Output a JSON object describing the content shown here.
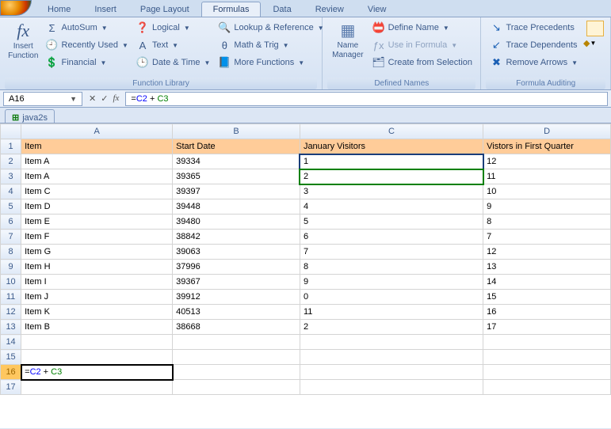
{
  "tabs": [
    "Home",
    "Insert",
    "Page Layout",
    "Formulas",
    "Data",
    "Review",
    "View"
  ],
  "active_tab": "Formulas",
  "ribbon": {
    "function_library": {
      "insert_function": "Insert Function",
      "items": [
        "AutoSum",
        "Recently Used",
        "Financial",
        "Logical",
        "Text",
        "Date & Time",
        "Lookup & Reference",
        "Math & Trig",
        "More Functions"
      ],
      "label": "Function Library"
    },
    "defined_names": {
      "name_manager": "Name Manager",
      "items": [
        "Define Name",
        "Use in Formula",
        "Create from Selection"
      ],
      "label": "Defined Names"
    },
    "formula_auditing": {
      "items": [
        "Trace Precedents",
        "Trace Dependents",
        "Remove Arrows"
      ],
      "label": "Formula Auditing"
    }
  },
  "name_box": "A16",
  "formula_bar": "=C2 + C3",
  "workbook_tab": "java2s",
  "columns": [
    "A",
    "B",
    "C",
    "D"
  ],
  "headers": [
    "Item",
    "Start Date",
    "January Visitors",
    "Vistors in First Quarter"
  ],
  "rows": [
    {
      "n": 1,
      "data": [
        "Item",
        "Start Date",
        "January Visitors",
        "Vistors in First Quarter"
      ],
      "header": true
    },
    {
      "n": 2,
      "data": [
        "Item A",
        "39334",
        "1",
        "12"
      ]
    },
    {
      "n": 3,
      "data": [
        "Item A",
        "39365",
        "2",
        "11"
      ]
    },
    {
      "n": 4,
      "data": [
        "Item C",
        "39397",
        "3",
        "10"
      ]
    },
    {
      "n": 5,
      "data": [
        "Item D",
        "39448",
        "4",
        "9"
      ]
    },
    {
      "n": 6,
      "data": [
        "Item E",
        "39480",
        "5",
        "8"
      ]
    },
    {
      "n": 7,
      "data": [
        "Item F",
        "38842",
        "6",
        "7"
      ]
    },
    {
      "n": 8,
      "data": [
        "Item G",
        "39063",
        "7",
        "12"
      ]
    },
    {
      "n": 9,
      "data": [
        "Item H",
        "37996",
        "8",
        "13"
      ]
    },
    {
      "n": 10,
      "data": [
        "Item I",
        "39367",
        "9",
        "14"
      ]
    },
    {
      "n": 11,
      "data": [
        "Item J",
        "39912",
        "0",
        "15"
      ]
    },
    {
      "n": 12,
      "data": [
        "Item K",
        "40513",
        "11",
        "16"
      ]
    },
    {
      "n": 13,
      "data": [
        "Item B",
        "38668",
        "2",
        "17"
      ]
    },
    {
      "n": 14,
      "data": [
        "",
        "",
        "",
        ""
      ]
    },
    {
      "n": 15,
      "data": [
        "",
        "",
        "",
        ""
      ]
    },
    {
      "n": 16,
      "data": [
        "=C2 + C3",
        "",
        "",
        ""
      ],
      "active": true
    },
    {
      "n": 17,
      "data": [
        "",
        "",
        "",
        ""
      ]
    }
  ],
  "range_highlight": {
    "blue": "C2",
    "green": "C3"
  },
  "icons": {
    "autosum": "Σ",
    "recent": "🕘",
    "financial": "💲",
    "logical": "❓",
    "text": "A",
    "datetime": "🕒",
    "lookup": "🔍",
    "math": "θ",
    "more": "📘",
    "define": "📛",
    "use": "ƒx",
    "create": "🗂",
    "trace_p": "↘",
    "trace_d": "↙",
    "remove": "✖"
  }
}
